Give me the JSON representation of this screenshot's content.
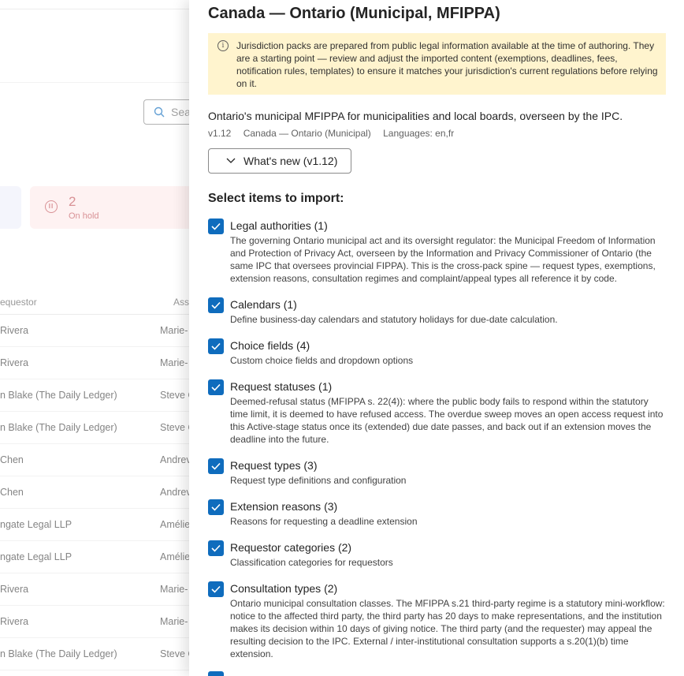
{
  "background": {
    "search_placeholder": "Sea",
    "stat_count": "2",
    "stat_label": "On hold",
    "headers": {
      "requestor": "equestor",
      "assignee": "Assi"
    },
    "rows": [
      {
        "requestor": "Rivera",
        "assignee": "Marie-"
      },
      {
        "requestor": "Rivera",
        "assignee": "Marie-"
      },
      {
        "requestor": "n Blake (The Daily Ledger)",
        "assignee": "Steve C"
      },
      {
        "requestor": "n Blake (The Daily Ledger)",
        "assignee": "Steve C"
      },
      {
        "requestor": "Chen",
        "assignee": "Andrev"
      },
      {
        "requestor": "Chen",
        "assignee": "Andrev"
      },
      {
        "requestor": "ngate Legal LLP",
        "assignee": "Amélie"
      },
      {
        "requestor": "ngate Legal LLP",
        "assignee": "Amélie"
      },
      {
        "requestor": "Rivera",
        "assignee": "Marie-"
      },
      {
        "requestor": "Rivera",
        "assignee": "Marie-"
      },
      {
        "requestor": "n Blake (The Daily Ledger)",
        "assignee": "Steve C"
      }
    ]
  },
  "drawer": {
    "title": "Canada — Ontario (Municipal, MFIPPA)",
    "notice": "Jurisdiction packs are prepared from public legal information available at the time of authoring. They are a starting point — review and adjust the imported content (exemptions, deadlines, fees, notification rules, templates) to ensure it matches your jurisdiction's current regulations before relying on it.",
    "description": "Ontario's municipal MFIPPA for municipalities and local boards, overseen by the IPC.",
    "meta": {
      "version": "v1.12",
      "jurisdiction": "Canada — Ontario (Municipal)",
      "languages": "Languages: en,fr"
    },
    "whats_new_label": "What's new (v1.12)",
    "select_heading": "Select items to import:",
    "items": [
      {
        "name": "Legal authorities (1)",
        "checked": true,
        "description": "The governing Ontario municipal act and its oversight regulator: the Municipal Freedom of Information and Protection of Privacy Act, overseen by the Information and Privacy Commissioner of Ontario (the same IPC that oversees provincial FIPPA). This is the cross-pack spine — request types, exemptions, extension reasons, consultation regimes and complaint/appeal types all reference it by code."
      },
      {
        "name": "Calendars (1)",
        "checked": true,
        "description": "Define business-day calendars and statutory holidays for due-date calculation."
      },
      {
        "name": "Choice fields (4)",
        "checked": true,
        "description": "Custom choice fields and dropdown options"
      },
      {
        "name": "Request statuses (1)",
        "checked": true,
        "description": "Deemed-refusal status (MFIPPA s. 22(4)): where the public body fails to respond within the statutory time limit, it is deemed to have refused access. The overdue sweep moves an open access request into this Active-stage status once its (extended) due date passes, and back out if an extension moves the deadline into the future."
      },
      {
        "name": "Request types (3)",
        "checked": true,
        "description": "Request type definitions and configuration"
      },
      {
        "name": "Extension reasons (3)",
        "checked": true,
        "description": "Reasons for requesting a deadline extension"
      },
      {
        "name": "Requestor categories (2)",
        "checked": true,
        "description": "Classification categories for requestors"
      },
      {
        "name": "Consultation types (2)",
        "checked": true,
        "description": "Ontario municipal consultation classes. The MFIPPA s.21 third-party regime is a statutory mini-workflow: notice to the affected third party, the third party has 20 days to make representations, and the institution makes its decision within 10 days of giving notice. The third party (and the requester) may appeal the resulting decision to the IPC. External / inter-institutional consultation supports a s.20(1)(b) time extension."
      }
    ]
  },
  "colors": {
    "accent": "#0f6cbd",
    "notice_bg": "#fff4ce",
    "onhold": "#c4565c"
  }
}
